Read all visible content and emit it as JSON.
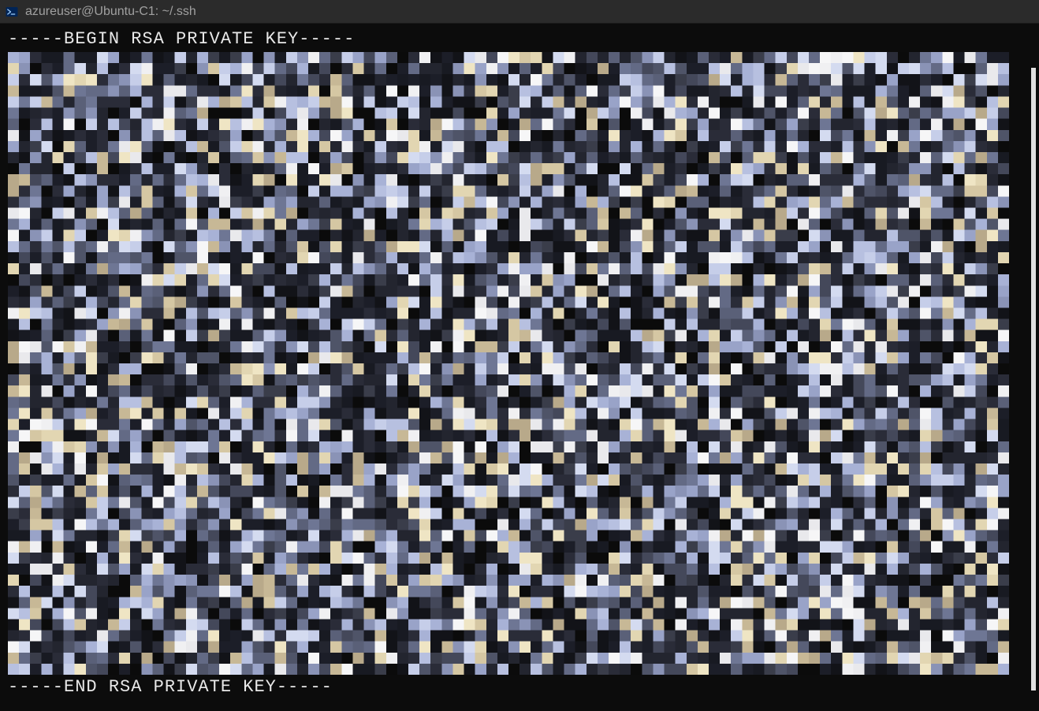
{
  "titlebar": {
    "icon_name": "powershell-icon",
    "title": "azureuser@Ubuntu-C1: ~/.ssh"
  },
  "terminal": {
    "key_header": "-----BEGIN RSA PRIVATE KEY-----",
    "key_footer": "-----END RSA PRIVATE KEY-----",
    "redacted_body_note": "pixelated/obscured key body"
  }
}
